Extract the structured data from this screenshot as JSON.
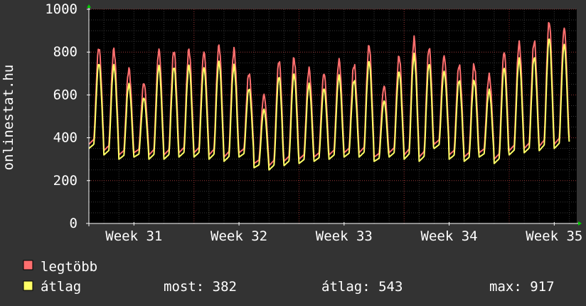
{
  "colors": {
    "background": "#333333",
    "plot_background": "#000000",
    "grid_minor": "#3a3a3a",
    "grid_major": "#8a2a2a",
    "axis": "#ffffff",
    "arrow": "#00cc00",
    "series_max": "#ff6f6f",
    "series_avg": "#ffff66"
  },
  "chart_data": {
    "type": "line",
    "ylabel": "onlinestat.hu",
    "ylim": [
      0,
      1000
    ],
    "yticks": [
      "0",
      "200",
      "400",
      "600",
      "800",
      "1000"
    ],
    "x_range_days": [
      -3,
      29.5
    ],
    "xticks": [
      {
        "label": "Week 31",
        "day": 0
      },
      {
        "label": "Week 32",
        "day": 7
      },
      {
        "label": "Week 33",
        "day": 14
      },
      {
        "label": "Week 34",
        "day": 21
      },
      {
        "label": "Week 35",
        "day": 28
      }
    ],
    "grid": true,
    "daily_peaks": [
      820,
      810,
      720,
      655,
      808,
      805,
      810,
      800,
      830,
      810,
      700,
      600,
      760,
      770,
      720,
      700,
      760,
      740,
      830,
      640,
      780,
      860,
      820,
      780,
      740,
      740,
      690,
      800,
      840,
      850,
      940,
      910
    ],
    "daily_troughs": [
      370,
      340,
      320,
      330,
      320,
      320,
      330,
      330,
      320,
      310,
      330,
      280,
      270,
      290,
      300,
      310,
      320,
      330,
      330,
      310,
      330,
      320,
      310,
      370,
      320,
      310,
      330,
      300,
      340,
      350,
      360,
      370
    ],
    "series": [
      {
        "name": "legtöbb",
        "key": "max",
        "color": "#ff6f6f"
      },
      {
        "name": "átlag",
        "key": "avg",
        "color": "#ffff66"
      }
    ],
    "end_value": 382
  },
  "legend": {
    "items": [
      {
        "label": "legtöbb",
        "color": "#ff6f6f"
      },
      {
        "label": "átlag",
        "color": "#ffff66"
      }
    ],
    "stats": {
      "now": "most: 382",
      "avg": "átlag: 543",
      "max": "max: 917"
    }
  }
}
